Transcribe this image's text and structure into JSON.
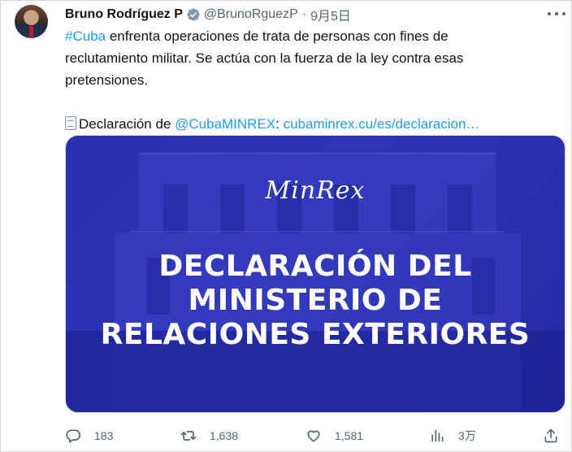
{
  "tweet": {
    "author_name": "Bruno Rodríguez P",
    "handle": "@BrunoRguezP",
    "separator": "·",
    "date": "9月5日",
    "hashtag": "#Cuba",
    "text_line1_rest": " enfrenta operaciones de trata de personas con fines de",
    "text_line2": "reclutamiento militar. Se actúa con la fuerza de la ley contra esas",
    "text_line3": "pretensiones.",
    "decl_prefix": "Declaración de ",
    "mention": "@CubaMINREX",
    "decl_colon": ": ",
    "url": "cubaminrex.cu/es/declaracion…"
  },
  "media": {
    "logo_text": "MinRex",
    "headline_line1": "DECLARACIÓN DEL",
    "headline_line2": "MINISTERIO DE",
    "headline_line3": "RELACIONES EXTERIORES",
    "overlay_color": "#2a2fb0"
  },
  "actions": {
    "replies": "183",
    "retweets": "1,638",
    "likes": "1,581",
    "views": "3万"
  },
  "colors": {
    "link": "#1d9bf0",
    "secondary_text": "#536471",
    "verified": "#829aab"
  }
}
